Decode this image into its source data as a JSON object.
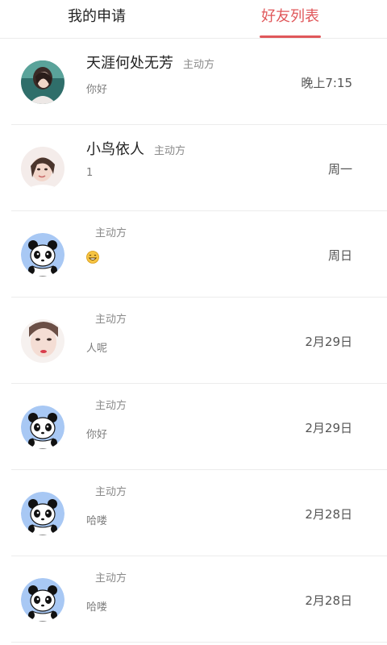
{
  "tabs": {
    "my_requests": "我的申请",
    "friends_list": "好友列表",
    "active_color": "#e0575a"
  },
  "friends": [
    {
      "name": "天涯何处无芳",
      "role": "主动方",
      "message": "你好",
      "time": "晚上7:15",
      "avatar": "photo-woman-1"
    },
    {
      "name": "小鸟依人",
      "role": "主动方",
      "message": "1",
      "time": "周一",
      "avatar": "photo-woman-2"
    },
    {
      "name": "",
      "role": "主动方",
      "message": "😄",
      "time": "周日",
      "avatar": "panda"
    },
    {
      "name": "",
      "role": "主动方",
      "message": "人呢",
      "time": "2月29日",
      "avatar": "photo-woman-3"
    },
    {
      "name": "",
      "role": "主动方",
      "message": "你好",
      "time": "2月29日",
      "avatar": "panda"
    },
    {
      "name": "",
      "role": "主动方",
      "message": "哈喽",
      "time": "2月28日",
      "avatar": "panda"
    },
    {
      "name": "",
      "role": "主动方",
      "message": "哈喽",
      "time": "2月28日",
      "avatar": "panda"
    }
  ]
}
